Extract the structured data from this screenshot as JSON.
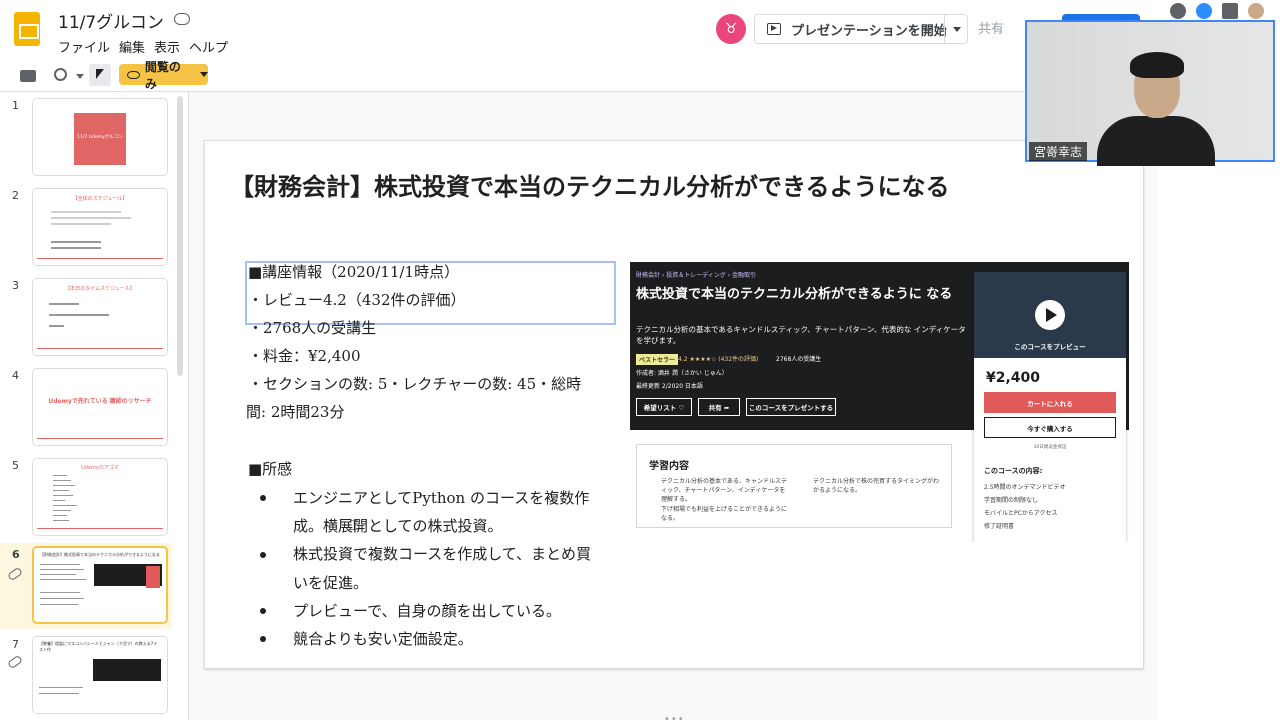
{
  "app": {
    "doc_title": "11/7グルコン",
    "menu": [
      "ファイル",
      "編集",
      "表示",
      "ヘルプ"
    ],
    "present_label": "プレゼンテーションを開始",
    "share_label": "共有",
    "view_only_label": "閲覧のみ"
  },
  "filmstrip": {
    "slides": [
      {
        "num": "1",
        "text": "11/7 Udemyグルコン"
      },
      {
        "num": "2",
        "text": "【全体のスケジュール】"
      },
      {
        "num": "3",
        "text": "【本日のタイムスケジュール】"
      },
      {
        "num": "4",
        "text": "Udemyで売れている 講師のリサーチ"
      },
      {
        "num": "5",
        "text": "Udemyのアゴマ"
      },
      {
        "num": "6",
        "text": "【財務会計】株式投資で本当のテクニカル分析ができるようになる"
      },
      {
        "num": "7",
        "text": "【教養】相談にマスコンバレー人とジャン（ア活マ）の教える7テスト作"
      }
    ],
    "selected_index": 6
  },
  "slide": {
    "title": "【財務会計】株式投資で本当のテクニカル分析ができるようになる",
    "info_lines": [
      "■講座情報（2020/11/1時点）",
      "・レビュー4.2（432件の評価）",
      "・2768人の受講生",
      "・料金：¥2,400",
      "・セクションの数: 5・レクチャーの数: 45・総時",
      "間: 2時間23分"
    ],
    "impressions_heading": "■所感",
    "impressions": [
      "エンジニアとしてPython のコースを複数作",
      "成。横展開としての株式投資。",
      "株式投資で複数コースを作成して、まとめ買",
      "いを促進。",
      "プレビューで、自身の顔を出している。",
      "競合よりも安い定価設定。"
    ]
  },
  "udemy": {
    "breadcrumb": "財務会計 › 投資＆トレーディング › 金融取引",
    "course_title": "株式投資で本当のテクニカル分析ができるように なる",
    "description": "テクニカル分析の基本であるキャンドルスティック、チャートパターン、代表的な インディケータを学びます。",
    "badge": "ベストセラー",
    "rating": "4.2 ★★★★☆ (432件の評価)",
    "students": "2768人の受講生",
    "author": "作成者: 酒井 潤（さかい じゅん）",
    "updated": "最終更新 2/2020   日本語",
    "wishlist_btn": "希望リスト ♡",
    "share_btn": "共有 ➦",
    "gift_btn": "このコースをプレゼントする",
    "preview_label": "このコースをプレビュー",
    "price": "¥2,400",
    "cart_btn": "カートに入れる",
    "buy_btn": "今すぐ購入する",
    "guarantee": "30日間返金保証",
    "includes_title": "このコースの内容:",
    "includes": [
      "2.5時間のオンデマンドビデオ",
      "学習期間の制限なし",
      "モバイルとPCからアクセス",
      "修了証明書"
    ],
    "learn_title": "学習内容",
    "learn_points": [
      "テクニカル分析の基本である、キャンドルスティック、チャートパターン、インディケータを理解する。",
      "テクニカル分析で株の売買するタイミングがわかるようになる。",
      "下げ相場でも利益を上げることができるようになる。"
    ]
  },
  "webcam": {
    "name": "宮嵜幸志"
  },
  "colors": {
    "accent_yellow": "#f6c445",
    "slides_yellow": "#f4b400",
    "udemy_dark": "#1c1d1f",
    "udemy_red": "#e05a5a",
    "thumb_red": "#e06666"
  }
}
